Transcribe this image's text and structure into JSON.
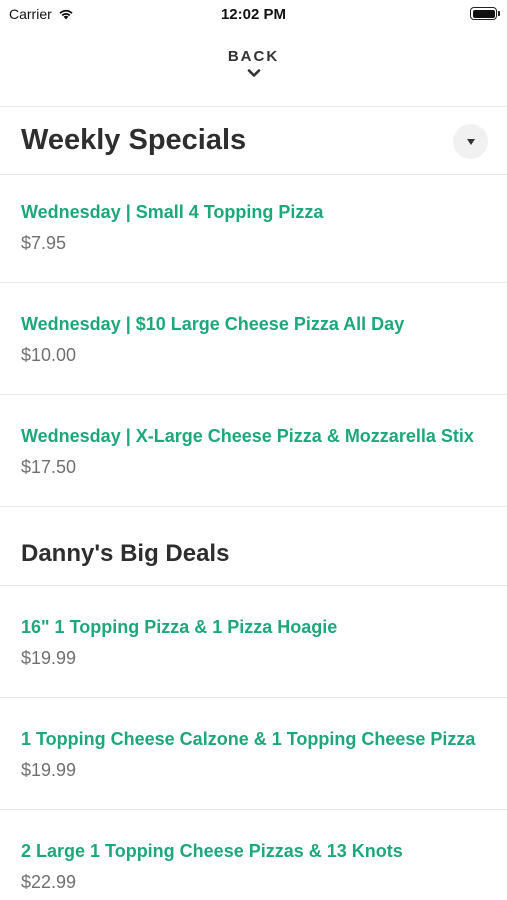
{
  "status_bar": {
    "carrier": "Carrier",
    "time": "12:02 PM"
  },
  "nav": {
    "back_label": "BACK"
  },
  "sections": [
    {
      "title": "Weekly Specials",
      "items": [
        {
          "name": "Wednesday | Small 4 Topping Pizza",
          "price": "$7.95"
        },
        {
          "name": "Wednesday | $10 Large Cheese Pizza All Day",
          "price": "$10.00"
        },
        {
          "name": "Wednesday | X-Large Cheese Pizza & Mozzarella Stix",
          "price": "$17.50"
        }
      ]
    },
    {
      "title": "Danny's Big Deals",
      "items": [
        {
          "name": "16\" 1 Topping Pizza & 1 Pizza Hoagie",
          "price": "$19.99"
        },
        {
          "name": "1 Topping Cheese Calzone & 1 Topping Cheese Pizza",
          "price": "$19.99"
        },
        {
          "name": "2 Large 1 Topping Cheese Pizzas & 13 Knots",
          "price": "$22.99"
        }
      ]
    }
  ],
  "colors": {
    "accent": "#1ea77a",
    "price": "#707070",
    "divider": "#e8e8e8"
  },
  "icons": {
    "dropdown": "caret-down-icon",
    "back": "chevron-down-icon"
  }
}
